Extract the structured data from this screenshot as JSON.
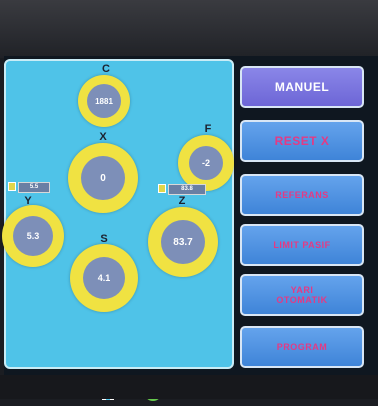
{
  "axes": {
    "c": {
      "label": "C",
      "value": "1881"
    },
    "x": {
      "label": "X",
      "value": "0"
    },
    "f": {
      "label": "F",
      "value": "-2"
    },
    "y": {
      "label": "Y",
      "value": "5.3",
      "badge": "5.5"
    },
    "z": {
      "label": "Z",
      "value": "83.7",
      "badge": "83.8"
    },
    "s": {
      "label": "S",
      "value": "4.1"
    }
  },
  "buttons": {
    "manuel": "MANUEL",
    "reset_x": "RESET X",
    "referans": "REFERANS",
    "limit_pasif": "LIMIT PASIF",
    "yari_otomatik": "YARI OTOMATIK",
    "program": "PROGRAM"
  },
  "icons": {
    "home": "home-icon",
    "status": "status-indicator-icon"
  },
  "colors": {
    "panel": "#4fc3e8",
    "ring": "#f0e242",
    "core": "#7d8fb8",
    "button": "#4a8fe0",
    "button_active": "#7b76e0",
    "button_text": "#e43a84"
  }
}
